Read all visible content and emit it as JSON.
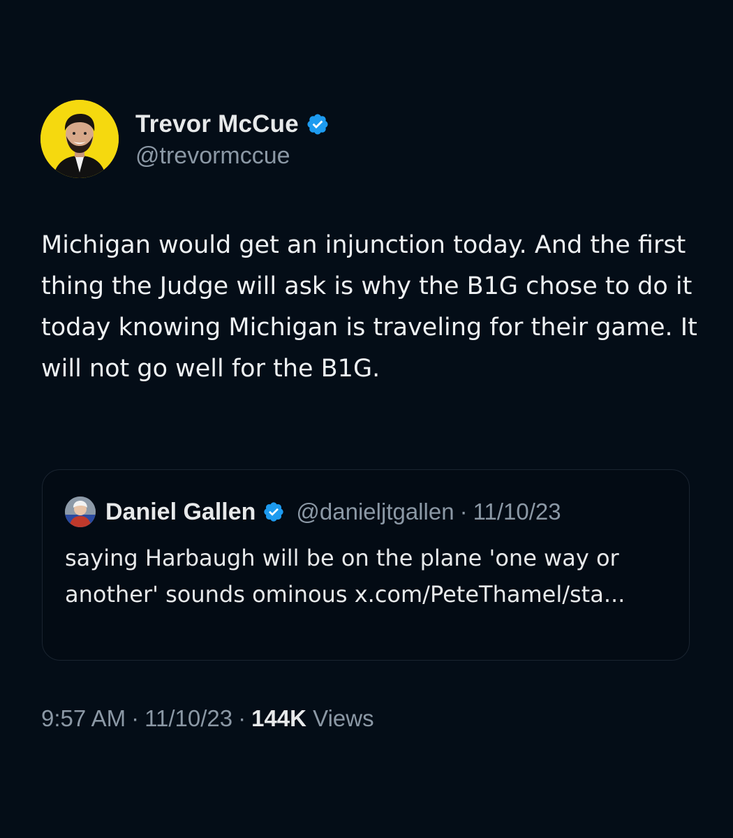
{
  "author": {
    "display_name": "Trevor McCue",
    "handle": "@trevormccue",
    "verified_icon": "verified-badge-icon",
    "avatar_color": "#f5d90f"
  },
  "tweet": {
    "text": "Michigan would get an injunction today. And the first thing the Judge will ask is why the B1G chose to do it today knowing Michigan is traveling for their game. It will not go well for the B1G."
  },
  "quote": {
    "display_name": "Daniel Gallen",
    "handle": "@danieljtgallen",
    "separator": "·",
    "date": "11/10/23",
    "text": "saying Harbaugh will be on the plane 'one way or another' sounds ominous x.com/PeteThamel/sta..."
  },
  "meta": {
    "time": "9:57 AM",
    "separator": "·",
    "date": "11/10/23",
    "views_count": "144K",
    "views_label": "Views"
  },
  "colors": {
    "background": "#040d17",
    "verified_blue": "#1d9bf0",
    "secondary_text": "#8b98a5"
  }
}
